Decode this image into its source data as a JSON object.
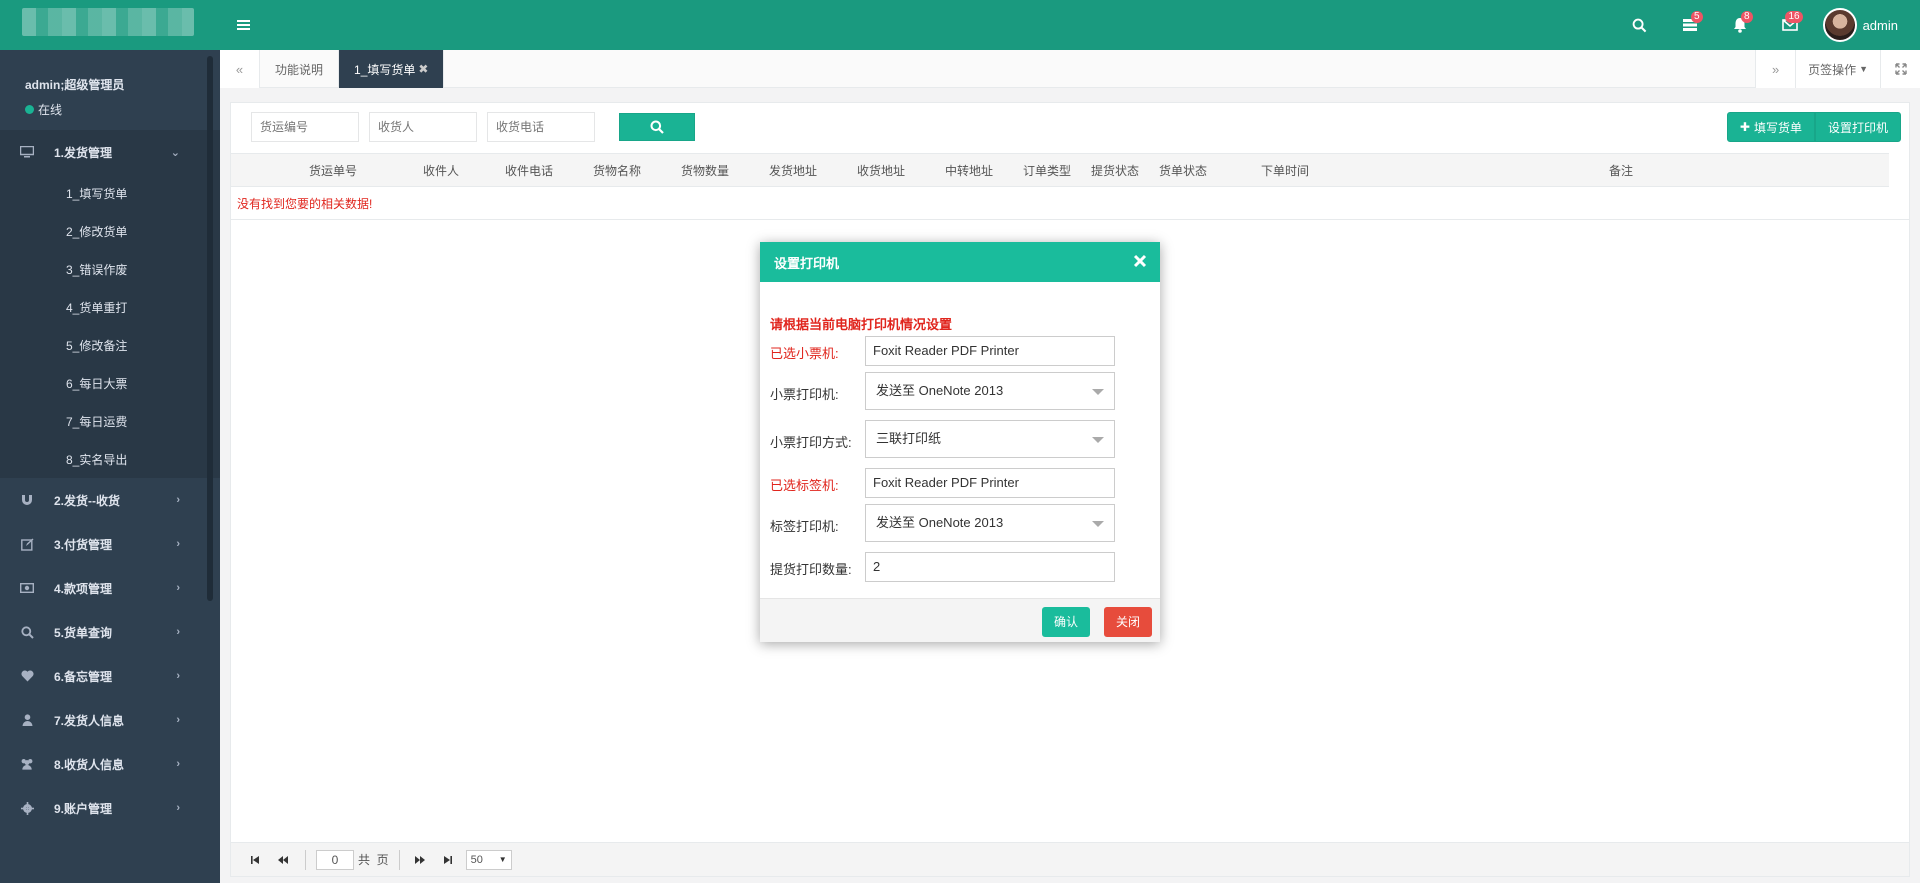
{
  "header": {
    "user_name": "admin",
    "badges": {
      "tasks": "5",
      "notifications": "8",
      "messages": "16"
    }
  },
  "sidebar": {
    "profile_name": "admin;超级管理员",
    "profile_status": "在线",
    "groups": [
      {
        "label": "1.发货管理",
        "icon": "monitor-icon",
        "expanded": true,
        "items": [
          "1_填写货单",
          "2_修改货单",
          "3_错误作废",
          "4_货单重打",
          "5_修改备注",
          "6_每日大票",
          "7_每日运费",
          "8_实名导出"
        ]
      },
      {
        "label": "2.发货--收货",
        "icon": "magnet-icon"
      },
      {
        "label": "3.付货管理",
        "icon": "edit-icon"
      },
      {
        "label": "4.款项管理",
        "icon": "money-icon"
      },
      {
        "label": "5.货单查询",
        "icon": "search-icon"
      },
      {
        "label": "6.备忘管理",
        "icon": "heart-icon"
      },
      {
        "label": "7.发货人信息",
        "icon": "user-icon"
      },
      {
        "label": "8.收货人信息",
        "icon": "users-icon"
      },
      {
        "label": "9.账户管理",
        "icon": "gear-icon"
      }
    ]
  },
  "tabs": {
    "items": [
      {
        "label": "功能说明",
        "active": false
      },
      {
        "label": "1_填写货单",
        "active": true,
        "closable": true
      }
    ],
    "ops_label": "页签操作"
  },
  "toolbar": {
    "waybill_placeholder": "货运编号",
    "receiver_placeholder": "收货人",
    "phone_placeholder": "收货电话",
    "fill_button": "填写货单",
    "printer_button": "设置打印机"
  },
  "table": {
    "columns": [
      "货运单号",
      "收件人",
      "收件电话",
      "货物名称",
      "货物数量",
      "发货地址",
      "收货地址",
      "中转地址",
      "订单类型",
      "提货状态",
      "货单状态",
      "下单时间",
      "备注"
    ],
    "empty_text": "没有找到您要的相关数据!"
  },
  "pager": {
    "page_value": "0",
    "total_label": "共  页",
    "page_size": "50"
  },
  "modal": {
    "title": "设置打印机",
    "heading": "请根据当前电脑打印机情况设置",
    "fields": [
      {
        "label": "已选小票机:",
        "value": "Foxit Reader PDF Printer",
        "kind": "text",
        "highlight": true
      },
      {
        "label": "小票打印机:",
        "value": "发送至 OneNote 2013",
        "kind": "select"
      },
      {
        "label": "小票打印方式:",
        "value": "三联打印纸",
        "kind": "select"
      },
      {
        "label": "已选标签机:",
        "value": "Foxit Reader PDF Printer",
        "kind": "text",
        "highlight": true
      },
      {
        "label": "标签打印机:",
        "value": "发送至 OneNote 2013",
        "kind": "select"
      },
      {
        "label": "提货打印数量:",
        "value": "2",
        "kind": "text"
      }
    ],
    "confirm_label": "确认",
    "close_label": "关闭"
  },
  "colors": {
    "header_bg": "#1a9a7f",
    "sidebar_bg": "#2f4050",
    "accent": "#1ab394",
    "danger": "#e74c3c",
    "warning_text": "#e0251d"
  }
}
